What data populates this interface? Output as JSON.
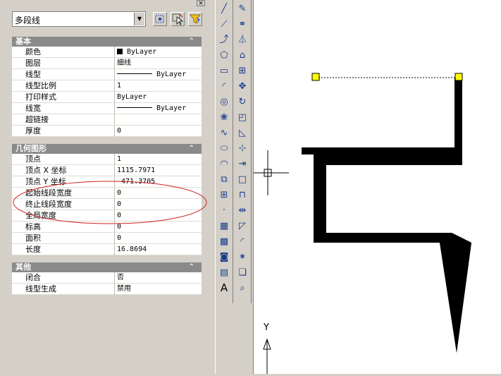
{
  "palette": {
    "close_glyph": "×",
    "object_type": "多段线",
    "sections": [
      {
        "title": "基本",
        "rows": [
          {
            "label": "颜色",
            "value": "ByLayer",
            "kind": "color"
          },
          {
            "label": "图层",
            "value": "细线",
            "kind": "text"
          },
          {
            "label": "线型",
            "value": "ByLayer",
            "kind": "line"
          },
          {
            "label": "线型比例",
            "value": "1",
            "kind": "text"
          },
          {
            "label": "打印样式",
            "value": "ByLayer",
            "kind": "text"
          },
          {
            "label": "线宽",
            "value": "ByLayer",
            "kind": "line"
          },
          {
            "label": "超链接",
            "value": "",
            "kind": "text"
          },
          {
            "label": "厚度",
            "value": "0",
            "kind": "text"
          }
        ]
      },
      {
        "title": "几何图形",
        "rows": [
          {
            "label": "顶点",
            "value": "1",
            "kind": "text"
          },
          {
            "label": "顶点 X 坐标",
            "value": "1115.7971",
            "kind": "text"
          },
          {
            "label": "顶点 Y 坐标",
            "value": "-471.3705",
            "kind": "text"
          },
          {
            "label": "起始线段宽度",
            "value": "0",
            "kind": "text"
          },
          {
            "label": "终止线段宽度",
            "value": "0",
            "kind": "text"
          },
          {
            "label": "全局宽度",
            "value": "0",
            "kind": "text"
          },
          {
            "label": "标高",
            "value": "0",
            "kind": "text"
          },
          {
            "label": "面积",
            "value": "0",
            "kind": "text"
          },
          {
            "label": "长度",
            "value": "16.8694",
            "kind": "text"
          }
        ]
      },
      {
        "title": "其他",
        "rows": [
          {
            "label": "闭合",
            "value": "否",
            "kind": "text"
          },
          {
            "label": "线型生成",
            "value": "禁用",
            "kind": "text"
          }
        ]
      }
    ]
  },
  "toolbar_draw": [
    "line-icon",
    "construction-line-icon",
    "polyline-icon",
    "polygon-icon",
    "rectangle-icon",
    "arc-icon",
    "circle-icon",
    "revision-cloud-icon",
    "spline-icon",
    "ellipse-icon",
    "ellipse-arc-icon",
    "insert-block-icon",
    "make-block-icon",
    "point-icon",
    "hatch-icon",
    "gradient-icon",
    "region-icon",
    "table-icon",
    "multiline-text-icon"
  ],
  "toolbar_modify": [
    "erase-icon",
    "copy-icon",
    "mirror-icon",
    "offset-icon",
    "array-icon",
    "move-icon",
    "rotate-icon",
    "scale-icon",
    "stretch-icon",
    "trim-icon",
    "extend-icon",
    "break-at-point-icon",
    "break-icon",
    "join-icon",
    "chamfer-icon",
    "fillet-icon",
    "explode-icon",
    "properties-icon",
    "zoom-icon"
  ],
  "canvas": {
    "ucs_y_label": "Y",
    "highlight_color": "#cc2222",
    "grip_color": "#ffff00"
  }
}
